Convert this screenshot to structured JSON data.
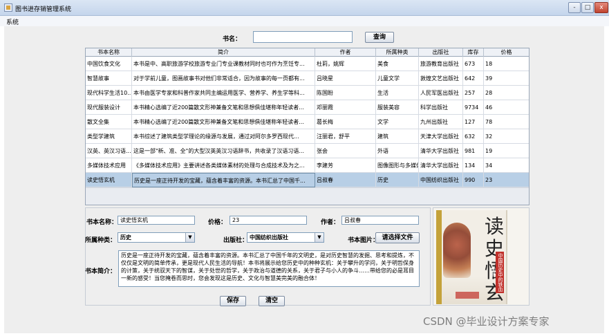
{
  "window": {
    "title": "图书进存销管理系统",
    "icon": "app-icon",
    "controls": {
      "minimize": "-",
      "maximize": "□",
      "close": "x"
    }
  },
  "menu": {
    "system": "系统"
  },
  "search": {
    "label": "书名：",
    "value": "",
    "button": "查询"
  },
  "table": {
    "columns": [
      "书本名称",
      "简介",
      "作者",
      "所属种类",
      "出版社",
      "库存",
      "价格"
    ],
    "rows": [
      [
        "中国饮食文化",
        "本书是中、高职旅游学校旅游专业门专业课教材同时也可作为烹饪专...",
        "杜莉，姚辉",
        "美食",
        "旅游教育出版社",
        "673",
        "18"
      ],
      [
        "智慧故事",
        "对于学前儿童，图画故事书对他们非常适合，因为故事的每一页都有...",
        "吕晓星",
        "儿童文学",
        "敦煌文艺出版社",
        "642",
        "39"
      ],
      [
        "现代科学生活10...",
        "本书由医学专家和科普作家共同主编运用医学、营养学、养生学等科...",
        "陈国盼",
        "生活",
        "人民军医出版社",
        "257",
        "28"
      ],
      [
        "现代服装设计",
        "本书精心选编了近200篇散文形神兼备文笔和思想俱佳堪称年轻读者...",
        "邓丽霞",
        "服装美容",
        "科学出版社",
        "9734",
        "46"
      ],
      [
        "散文全集",
        "本书精心选编了近200篇散文形神兼备文笔和思想俱佳堪称年轻读者...",
        "葛长梅",
        "文学",
        "九州出版社",
        "127",
        "78"
      ],
      [
        "类型学建筑",
        "本书综述了建筑类型学理论的缘源与发展，通过对阿尔多罗西现代...",
        "汪丽君，舒平",
        "建筑",
        "天津大学出版社",
        "632",
        "32"
      ],
      [
        "汉英、英汉习语...",
        "这是一部\"新、准、全\"的大型汉英英汉习语辞书，共收录了汉语习语...",
        "张会",
        "外语",
        "清华大学出版社",
        "981",
        "19"
      ],
      [
        "多媒体技术应用",
        "《多媒体技术应用》主要讲述各类媒体素材的处理与合成技术及为之...",
        "李建芳",
        "图像图形与多媒体",
        "清华大学出版社",
        "134",
        "34"
      ],
      [
        "读史悟玄机",
        "历史是一座正待开发的宝藏，蕴含着丰富的资源。本书汇总了中国千...",
        "吕叔春",
        "历史",
        "中国纺织出版社",
        "990",
        "23"
      ]
    ],
    "selected_row": 8
  },
  "form": {
    "name_label": "书本名称：",
    "name_value": "读史悟玄机",
    "price_label": "价格：",
    "price_value": "23",
    "author_label": "作者：",
    "author_value": "吕叔春",
    "category_label": "所属种类：",
    "category_value": "历史",
    "publisher_label": "出版社：",
    "publisher_value": "中国纺织出版社",
    "image_label": "书本图片：",
    "image_button": "请选择文件",
    "intro_label": "书本简介：",
    "intro_value": "历史是一座正待开发的宝藏，蕴含着丰富的资源。本书汇总了中国千年的文明史，是对历史智慧的发掘、思考和提炼，不仅仅是文明的简单传承，更是现代人民生活的导航！本书将展示给您历史中的种种玄机：关于攀升的学问，关于明哲保身的计策，关于统驭天下的智谋，关于处世的哲学，关于政治与道德的关系，关于君子与小人的争斗……带给您的必是耳目一新的感受！当您掩卷而思时，您会发现这是历史、文化与智慧美完美的融合体！",
    "save_button": "保存",
    "clear_button": "清空"
  },
  "cover": {
    "title": "读史悟玄机",
    "subtitle": "中国历史中的铁血风骨"
  },
  "watermark": "CSDN @毕业设计方案专家"
}
